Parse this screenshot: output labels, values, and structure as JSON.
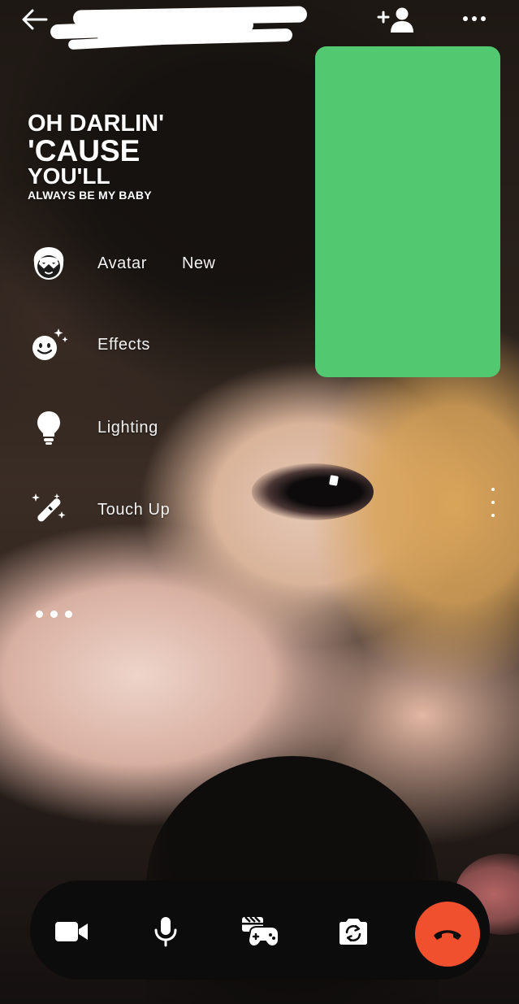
{
  "header": {
    "back_icon": "arrow-left-icon",
    "contact_name": "",
    "add_person_icon": "person-add-icon",
    "more_icon": "more-horizontal-icon"
  },
  "self_view": {
    "color": "#52c971"
  },
  "overlay_text": {
    "line1": "OH DARLIN'",
    "line2": "'CAUSE",
    "line3": "YOU'LL",
    "line4": "ALWAYS BE MY BABY"
  },
  "effects_menu": {
    "items": [
      {
        "label": "Avatar",
        "icon": "avatar-face-icon",
        "badge": "New"
      },
      {
        "label": "Effects",
        "icon": "sparkle-smiley-icon"
      },
      {
        "label": "Lighting",
        "icon": "lightbulb-icon"
      },
      {
        "label": "Touch Up",
        "icon": "magic-wand-icon"
      }
    ],
    "more_icon": "more-horizontal-icon"
  },
  "call_controls": {
    "video_icon": "video-camera-icon",
    "mic_icon": "microphone-icon",
    "activities_icon": "game-controller-icon",
    "flip_icon": "flip-camera-icon",
    "end_icon": "end-call-icon",
    "end_color": "#f0502e"
  }
}
